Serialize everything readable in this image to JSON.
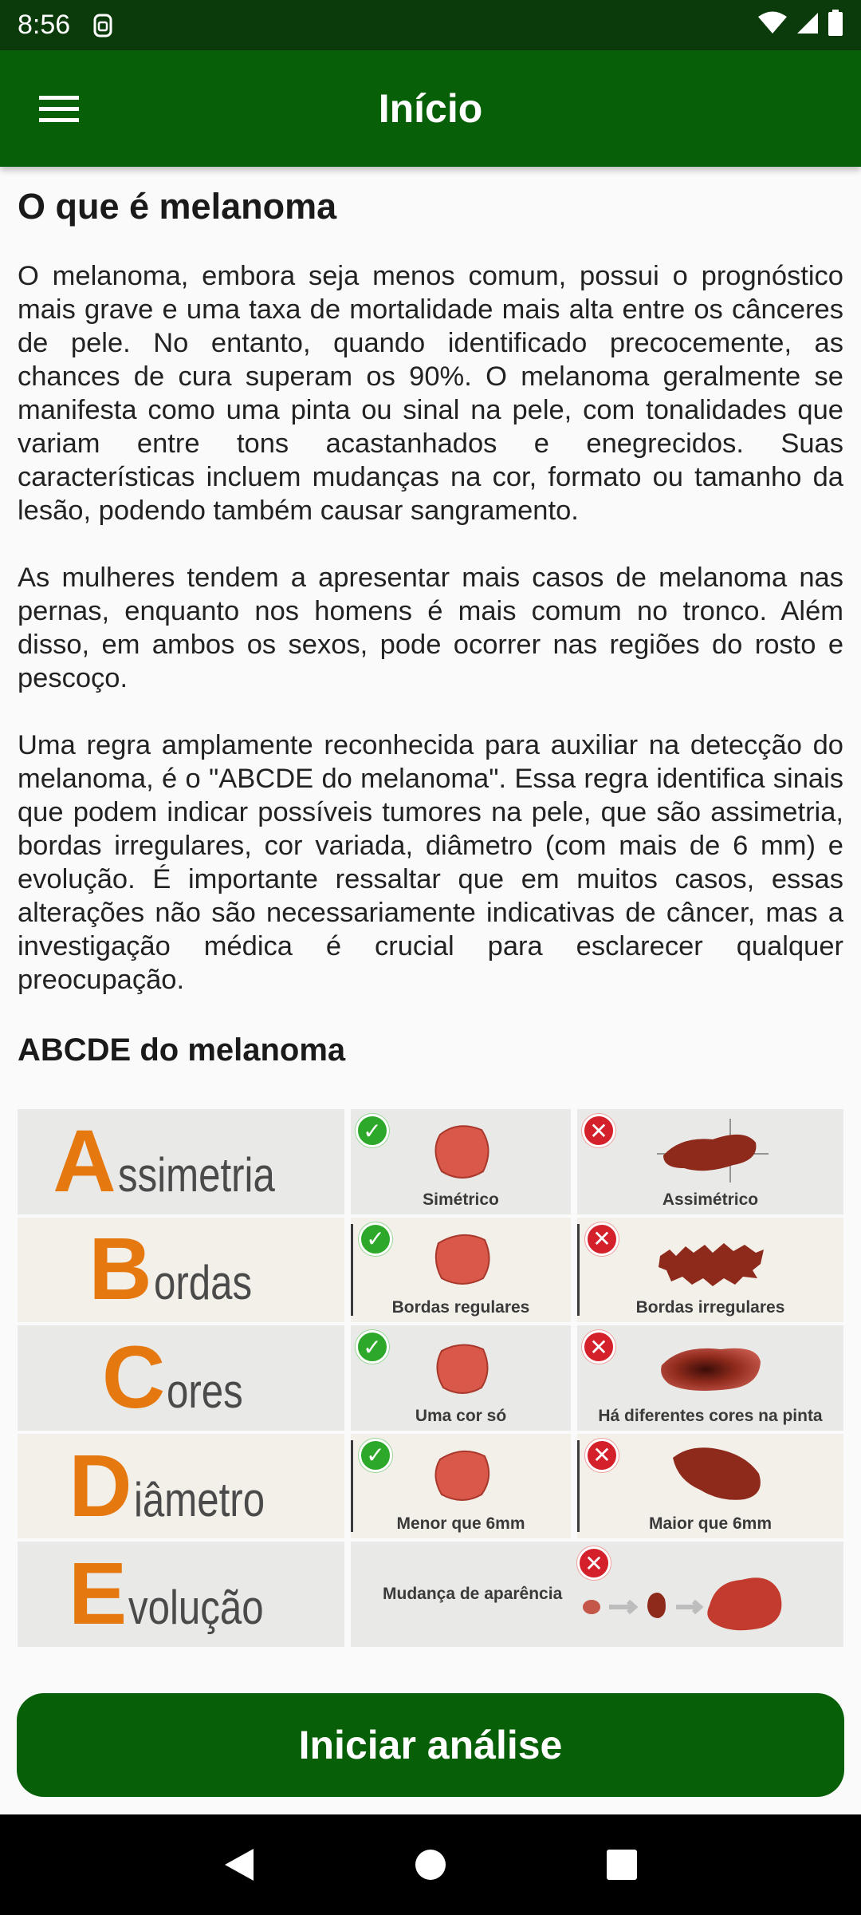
{
  "status_bar": {
    "time": "8:56",
    "icons": [
      "sim-icon",
      "wifi-icon",
      "signal-icon",
      "battery-icon"
    ]
  },
  "app_bar": {
    "title": "Início",
    "menu_icon": "hamburger-menu-icon",
    "background": "#075f07"
  },
  "content": {
    "heading": "O que é melanoma",
    "paragraphs": [
      "O melanoma, embora seja menos comum, possui o prognóstico mais grave e uma taxa de mortalidade mais alta entre os cânceres de pele. No entanto, quando identificado precocemente, as chances de cura superam os 90%. O melanoma geralmente se manifesta como uma pinta ou sinal na pele, com tonalidades que variam entre tons acastanhados e enegrecidos. Suas características incluem mudanças na cor, formato ou tamanho da lesão, podendo também causar sangramento.",
      "As mulheres tendem a apresentar mais casos de melanoma nas pernas, enquanto nos homens é mais comum no tronco. Além disso, em ambos os sexos, pode ocorrer nas regiões do rosto e pescoço.",
      "Uma regra amplamente reconhecida para auxiliar na detecção do melanoma, é o \"ABCDE do melanoma\". Essa regra identifica sinais que podem indicar possíveis tumores na pele, que são assimetria, bordas irregulares, cor variada, diâmetro (com mais de 6 mm) e evolução. É importante ressaltar que em muitos casos, essas alterações não são necessariamente indicativas de câncer, mas a investigação médica é crucial para esclarecer qualquer preocupação."
    ],
    "abcde_heading": "ABCDE do melanoma"
  },
  "abcde": {
    "rows": [
      {
        "letter": "A",
        "rest": "ssimetria",
        "good": "Simétrico",
        "bad": "Assimétrico"
      },
      {
        "letter": "B",
        "rest": "ordas",
        "good": "Bordas regulares",
        "bad": "Bordas irregulares"
      },
      {
        "letter": "C",
        "rest": "ores",
        "good": "Uma cor só",
        "bad": "Há diferentes cores na pinta"
      },
      {
        "letter": "D",
        "rest": "iâmetro",
        "good": "Menor que 6mm",
        "bad": "Maior que 6mm"
      },
      {
        "letter": "E",
        "rest": "volução",
        "evolution": "Mudança de aparência"
      }
    ],
    "colors": {
      "letter": "#e5780f",
      "good": "#2ea82a",
      "bad": "#d3202a",
      "lesion_good": "#d9584a",
      "lesion_bad": "#8e2a1c"
    }
  },
  "button": {
    "label": "Iniciar análise"
  },
  "nav_bar": {
    "icons": [
      "back-icon",
      "home-icon",
      "recents-icon"
    ]
  }
}
